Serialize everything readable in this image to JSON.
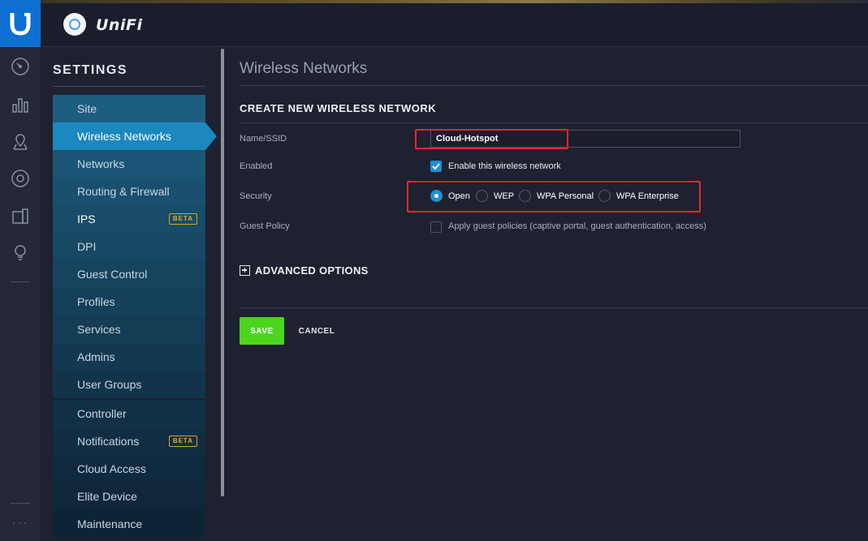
{
  "app": {
    "brand": "UniFi"
  },
  "rail": {
    "icons": [
      "dashboard-icon",
      "statistics-icon",
      "map-icon",
      "devices-icon",
      "clients-icon",
      "insights-icon"
    ],
    "more": "···"
  },
  "sidebar": {
    "title": "SETTINGS",
    "items": [
      {
        "label": "Site"
      },
      {
        "label": "Wireless Networks",
        "active": true
      },
      {
        "label": "Networks"
      },
      {
        "label": "Routing & Firewall"
      },
      {
        "label": "IPS",
        "badge": "BETA"
      },
      {
        "label": "DPI"
      },
      {
        "label": "Guest Control"
      },
      {
        "label": "Profiles"
      },
      {
        "label": "Services"
      },
      {
        "label": "Admins"
      },
      {
        "label": "User Groups"
      },
      {
        "label": "Controller"
      },
      {
        "label": "Notifications",
        "badge": "BETA"
      },
      {
        "label": "Cloud Access"
      },
      {
        "label": "Elite Device"
      },
      {
        "label": "Maintenance"
      }
    ]
  },
  "main": {
    "page_title": "Wireless Networks",
    "section_title": "CREATE NEW WIRELESS NETWORK",
    "form": {
      "name_label": "Name/SSID",
      "name_value": "Cloud-Hotspot",
      "enabled_label": "Enabled",
      "enabled_checkbox_label": "Enable this wireless network",
      "enabled_checked": true,
      "security_label": "Security",
      "security_options": [
        "Open",
        "WEP",
        "WPA Personal",
        "WPA Enterprise"
      ],
      "security_selected": "Open",
      "guest_policy_label": "Guest Policy",
      "guest_policy_checkbox_label": "Apply guest policies (captive portal, guest authentication, access)",
      "guest_policy_checked": false
    },
    "advanced_label": "ADVANCED OPTIONS",
    "save_label": "SAVE",
    "cancel_label": "CANCEL"
  },
  "colors": {
    "accent": "#1b88bf",
    "save": "#4bd51e",
    "highlight": "#e8262a",
    "badge": "#d6a41f"
  }
}
